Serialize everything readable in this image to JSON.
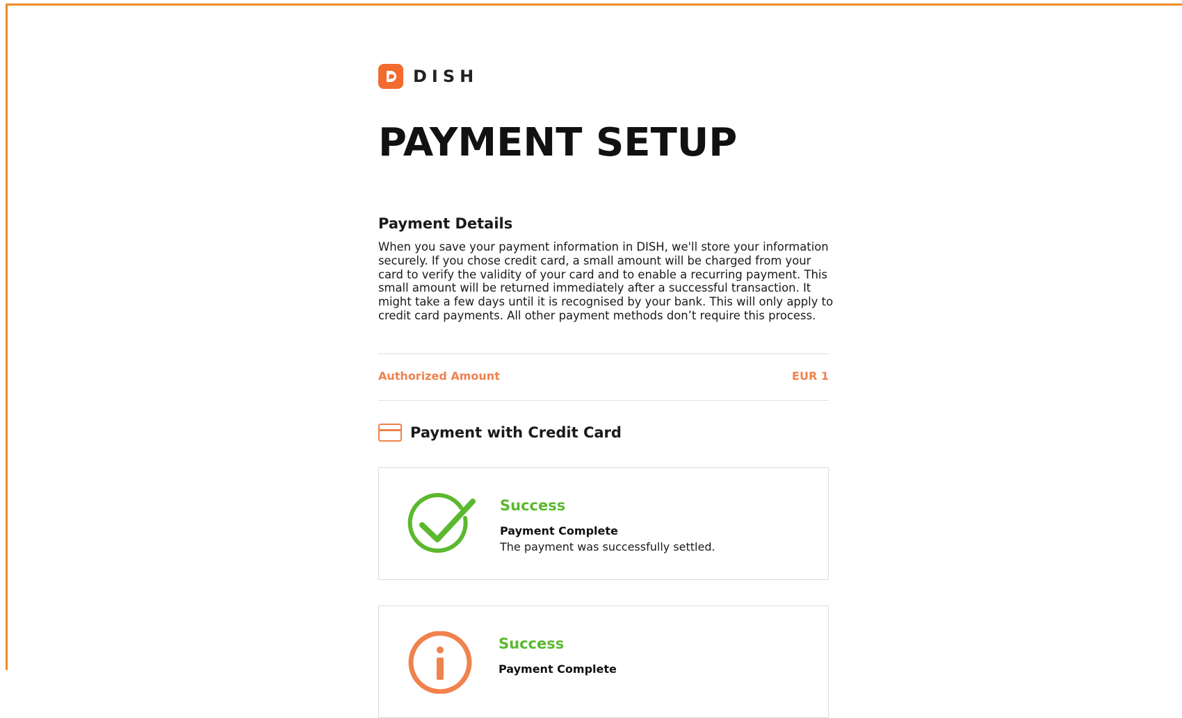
{
  "brand": {
    "logo_letter": "D",
    "name": "DISH",
    "accent_color": "#f26a2e"
  },
  "page": {
    "title": "PAYMENT SETUP"
  },
  "payment_details": {
    "heading": "Payment Details",
    "description": "When you save your payment information in DISH, we'll store your information securely. If you chose credit card, a small amount will be charged from your card to verify the validity of your card and to enable a recurring payment. This small amount will be returned immediately after a successful transaction. It might take a few days until it is recognised by your bank. This will only apply to credit card payments. All other payment methods don’t require this process.",
    "authorized_label": "Authorized Amount",
    "authorized_value": "EUR 1"
  },
  "payment_method": {
    "icon": "credit-card-icon",
    "title": "Payment with Credit Card"
  },
  "status_cards": [
    {
      "icon": "success-check-icon",
      "icon_color": "#5cb82e",
      "title": "Success",
      "subtitle": "Payment Complete",
      "text": "The payment was successfully settled."
    },
    {
      "icon": "info-icon",
      "icon_color": "#f0824e",
      "title": "Success",
      "subtitle": "Payment Complete",
      "text": ""
    }
  ],
  "colors": {
    "frame_border": "#f08a24",
    "success_green": "#5cb82e",
    "orange_text": "#f0824e"
  }
}
